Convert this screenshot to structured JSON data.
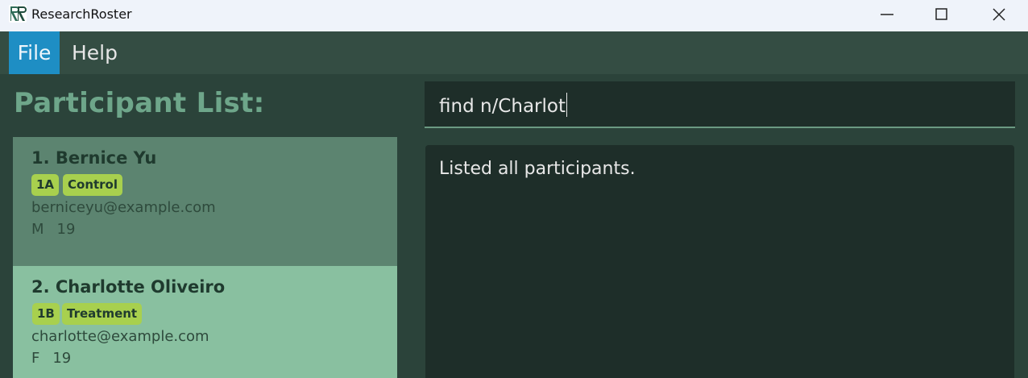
{
  "app": {
    "title": "ResearchRoster",
    "logo_letters": "RR"
  },
  "menu": {
    "items": [
      {
        "label": "File",
        "active": true
      },
      {
        "label": "Help",
        "active": false
      }
    ]
  },
  "participant_list": {
    "header": "Participant List:",
    "participants": [
      {
        "index_name": "1. Bernice Yu",
        "tags": [
          "1A",
          "Control"
        ],
        "email": "berniceyu@example.com",
        "gender": "M",
        "age": "19",
        "background": "#5c8470"
      },
      {
        "index_name": "2. Charlotte Oliveiro",
        "tags": [
          "1B",
          "Treatment"
        ],
        "email": "charlotte@example.com",
        "gender": "F",
        "age": "19",
        "background": "#89c0a0"
      }
    ]
  },
  "command": {
    "value": "find n/Charlot"
  },
  "result": {
    "message": "Listed all participants."
  },
  "colors": {
    "menu_active": "#1e8ec4",
    "tag": "#a8d04e",
    "header_text": "#6ea68a",
    "background": "#2b433a"
  }
}
